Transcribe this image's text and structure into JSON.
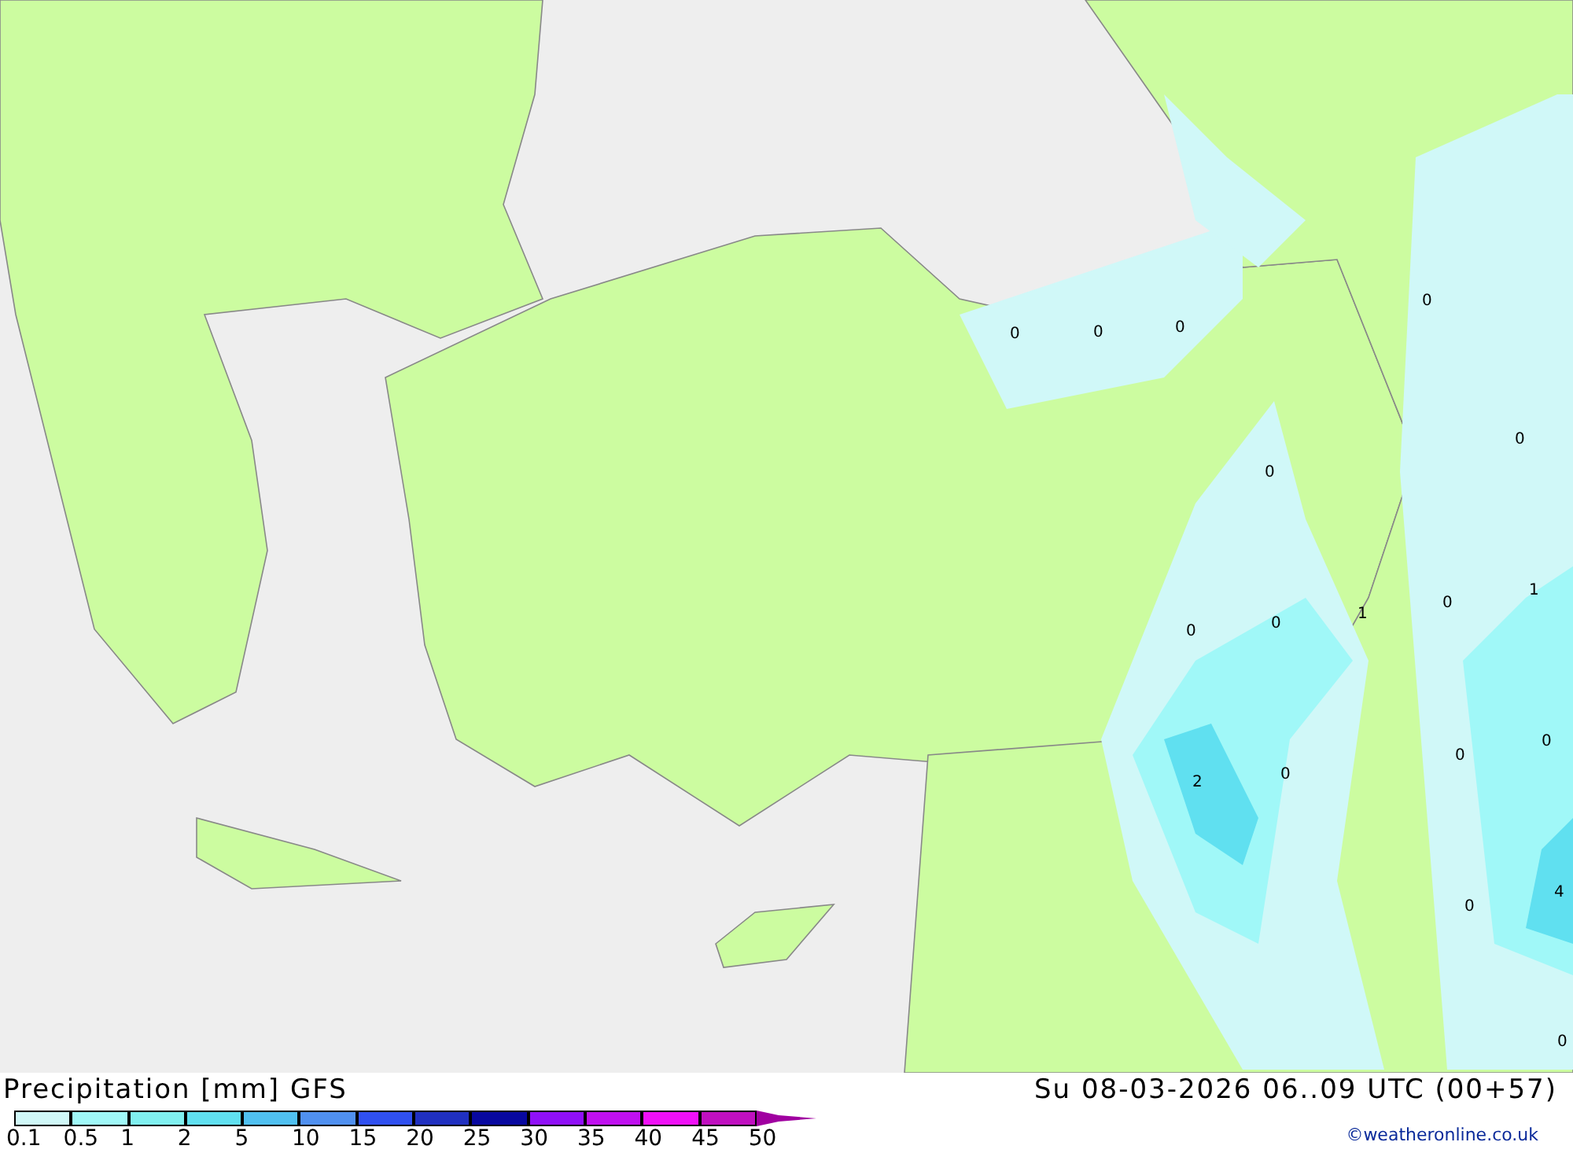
{
  "map": {
    "contour_labels": [
      "0",
      "0",
      "0",
      "0",
      "0",
      "0",
      "0",
      "0",
      "1",
      "0",
      "1",
      "0",
      "0",
      "2",
      "0",
      "0",
      "4",
      "0"
    ]
  },
  "title": "Precipitation [mm] GFS",
  "valid_time": "Su 08-03-2026 06..09 UTC (00+57)",
  "legend": {
    "steps": [
      {
        "label": "0.1",
        "color": "#d0f8f8"
      },
      {
        "label": "0.5",
        "color": "#a0f8f8"
      },
      {
        "label": "1",
        "color": "#80f0f0"
      },
      {
        "label": "2",
        "color": "#60e0f0"
      },
      {
        "label": "5",
        "color": "#50c0f0"
      },
      {
        "label": "10",
        "color": "#5090f0"
      },
      {
        "label": "15",
        "color": "#3050f0"
      },
      {
        "label": "20",
        "color": "#2030c0"
      },
      {
        "label": "25",
        "color": "#0808a0"
      },
      {
        "label": "30",
        "color": "#9010f8"
      },
      {
        "label": "35",
        "color": "#c010f0"
      },
      {
        "label": "40",
        "color": "#f010f8"
      },
      {
        "label": "45",
        "color": "#c010c0"
      }
    ],
    "max_label": "50"
  },
  "credit": "©weatheronline.co.uk"
}
